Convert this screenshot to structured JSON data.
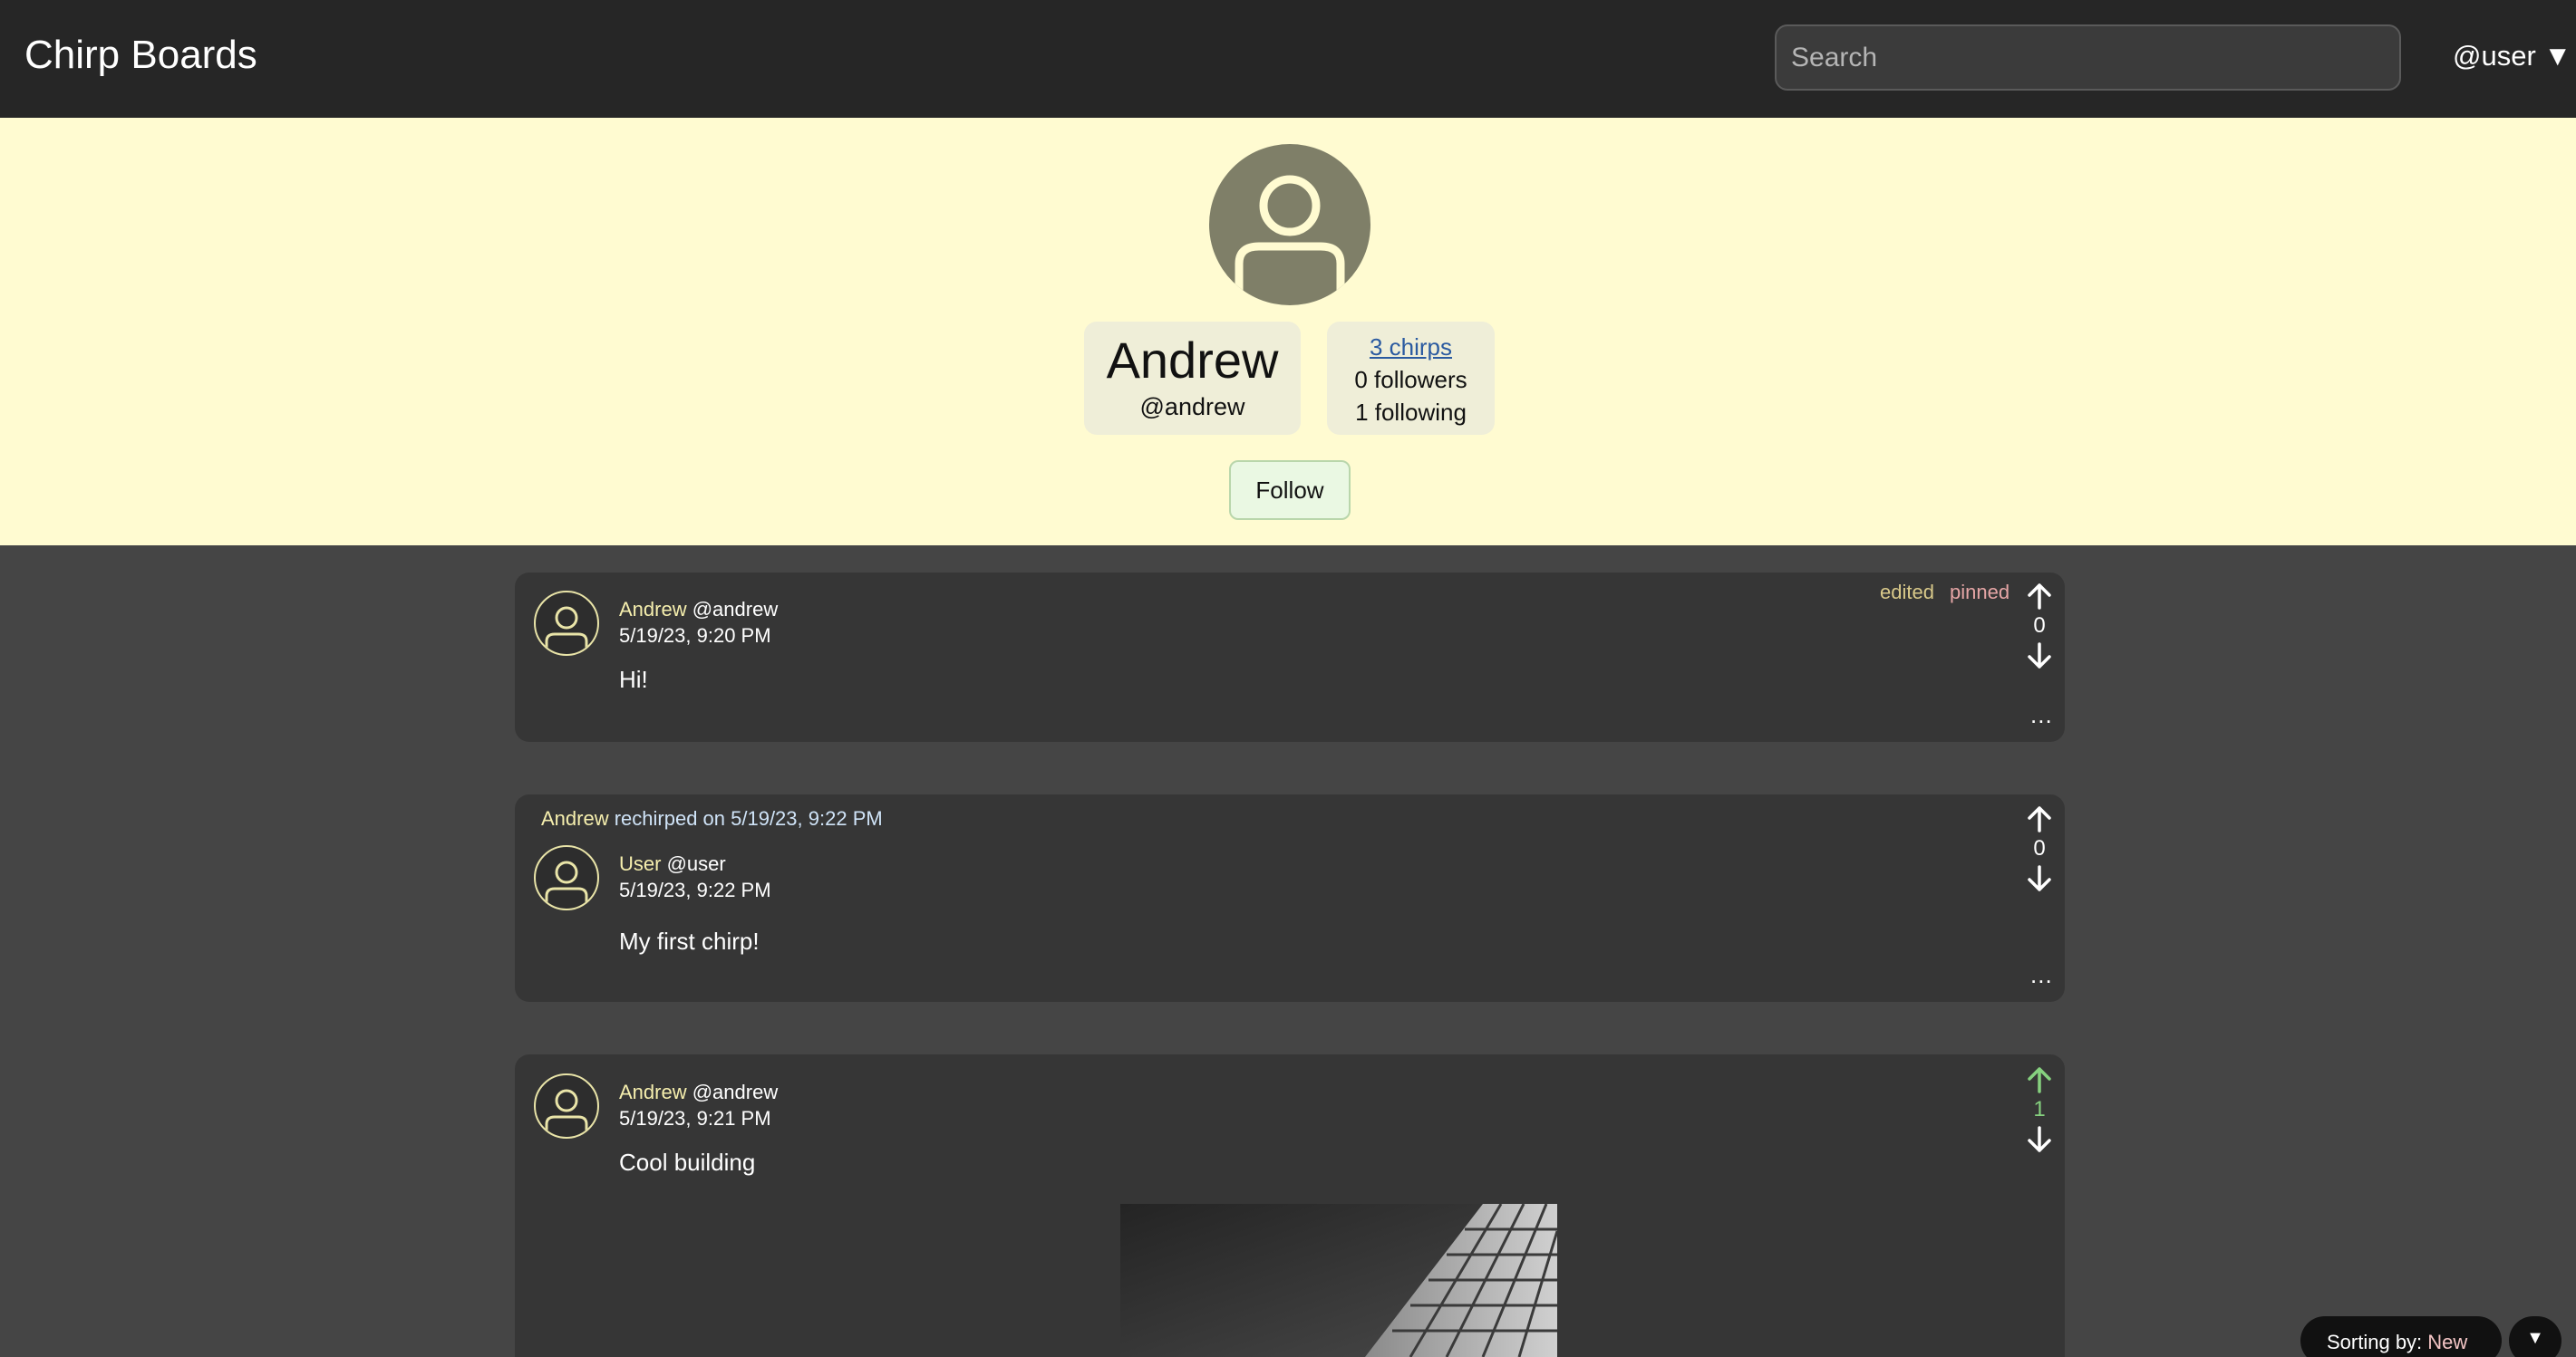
{
  "navbar": {
    "brand": "Chirp Boards",
    "search_placeholder": "Search",
    "user_menu": "@user ▼"
  },
  "profile": {
    "name": "Andrew",
    "handle": "@andrew",
    "chirps_link": "3 chirps",
    "followers": "0 followers",
    "following": "1 following",
    "follow_label": "Follow"
  },
  "feed": [
    {
      "author_name": "Andrew",
      "author_handle": "@andrew",
      "timestamp": "5/19/23, 9:20 PM",
      "text": "Hi!",
      "tag_edited": "edited",
      "tag_pinned": "pinned",
      "votes": "0",
      "vote_state": "none",
      "more": "..."
    },
    {
      "rechirp_by": "Andrew",
      "rechirp_info": "rechirped on 5/19/23, 9:22 PM",
      "author_name": "User",
      "author_handle": "@user",
      "timestamp": "5/19/23, 9:22 PM",
      "text": "My first chirp!",
      "votes": "0",
      "vote_state": "none",
      "more": "..."
    },
    {
      "author_name": "Andrew",
      "author_handle": "@andrew",
      "timestamp": "5/19/23, 9:21 PM",
      "text": "Cool building",
      "votes": "1",
      "vote_state": "upvoted",
      "has_image": true
    }
  ],
  "sorting": {
    "label": "Sorting by: ",
    "value": "New",
    "toggle": "▼"
  },
  "colors": {
    "navbar_bg": "#262626",
    "profile_bg": "#fffbd1",
    "feed_bg": "#454545",
    "card_bg": "#363636",
    "author_name": "#f6efae",
    "edited_tag": "#d9c98a",
    "pinned_tag": "#e6a6a6",
    "upvote_active": "#86d17f"
  },
  "icons": {
    "avatar": "person-silhouette-icon",
    "upvote": "arrow-up-icon",
    "downvote": "arrow-down-icon",
    "dropdown": "caret-down-icon"
  }
}
